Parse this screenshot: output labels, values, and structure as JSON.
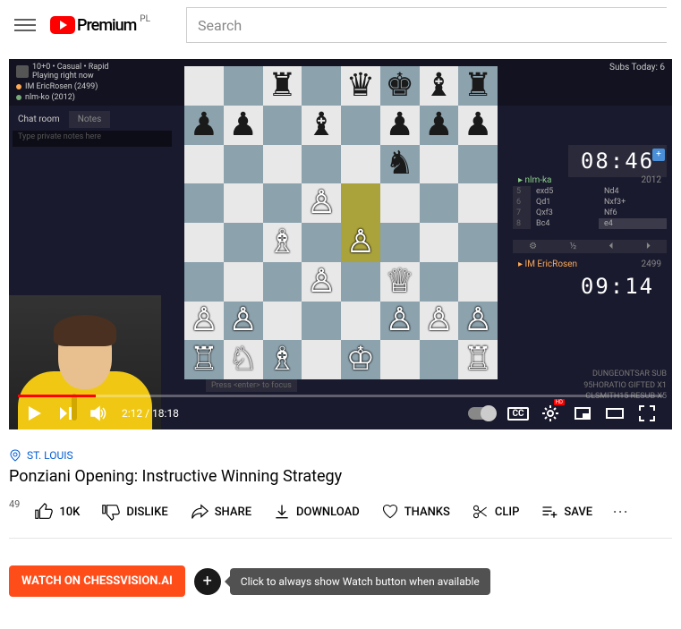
{
  "header": {
    "logo_text": "Premium",
    "country": "PL",
    "search_placeholder": "Search"
  },
  "player": {
    "subs_today": "Subs Today: 6",
    "game_mode": "10+0 • Casual • Rapid",
    "game_status": "Playing right now",
    "player1_tag": "IM EricRosen (2499)",
    "player2_tag": "nlm-ko (2012)",
    "chat_tab": "Chat room",
    "notes_tab": "Notes",
    "chat_placeholder": "Type private notes here",
    "clock_top": "08:46",
    "clock_bottom": "09:14",
    "top_player_name": "nlm-ka",
    "top_player_rating": "2012",
    "bottom_player_name": "IM EricRosen",
    "bottom_player_rating": "2499",
    "moves": [
      {
        "n": "5",
        "w": "exd5",
        "b": "Nd4"
      },
      {
        "n": "6",
        "w": "Qd1",
        "b": "Nxf3+"
      },
      {
        "n": "7",
        "w": "Qxf3",
        "b": "Nf6"
      },
      {
        "n": "8",
        "w": "Bc4",
        "b": "e4"
      }
    ],
    "move_ctrl": [
      "⚙",
      "½",
      "⏴",
      "⏵"
    ],
    "press_enter": "Press <enter> to focus",
    "subs_list": [
      "DUNGEONTSAR  SUB",
      "95HORATIO  GIFTED X1",
      "CLSMITH15  RESUB X5"
    ],
    "time_current": "2:12",
    "time_total": "18:18"
  },
  "board": {
    "rows": [
      [
        "",
        "",
        "r",
        "",
        "q",
        "k",
        "b",
        "r"
      ],
      [
        "p",
        "p",
        "",
        "b",
        "",
        "p",
        "p",
        "p"
      ],
      [
        "",
        "",
        "",
        "",
        "",
        "n",
        "",
        ""
      ],
      [
        "",
        "",
        "",
        "P",
        "HL",
        "",
        "",
        ""
      ],
      [
        "",
        "",
        "B",
        "",
        "PHL",
        "",
        "",
        ""
      ],
      [
        "",
        "",
        "",
        "P",
        "",
        "Q",
        "",
        ""
      ],
      [
        "P",
        "P",
        "",
        "",
        "",
        "P",
        "P",
        "P"
      ],
      [
        "R",
        "N",
        "B",
        "",
        "K",
        "",
        "",
        "R"
      ]
    ]
  },
  "meta": {
    "location": "ST. LOUIS",
    "title": "Ponziani Opening: Instructive Winning Strategy",
    "rank": "49",
    "likes": "10K",
    "dislike": "DISLIKE",
    "share": "SHARE",
    "download": "DOWNLOAD",
    "thanks": "THANKS",
    "clip": "CLIP",
    "save": "SAVE"
  },
  "ext": {
    "watch": "WATCH ON CHESSVISION.AI",
    "tooltip": "Click to always show Watch button when available"
  }
}
